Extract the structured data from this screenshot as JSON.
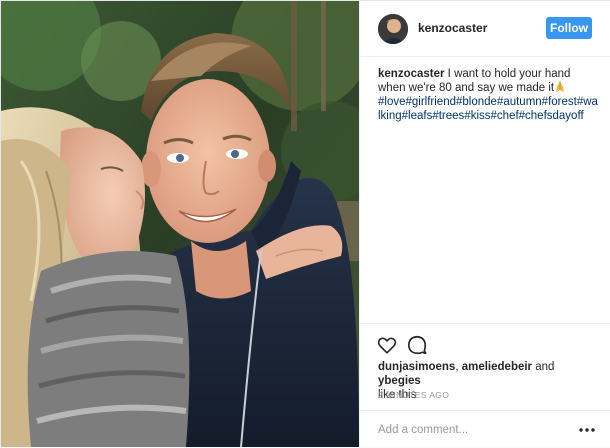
{
  "post": {
    "username": "kenzocaster",
    "follow_label": "Follow",
    "caption": {
      "username": "kenzocaster",
      "text": " I want to hold your hand when we're 80 and say we made it",
      "emoji": "praying-hands-emoji",
      "hashtags": "#love#girlfriend#blonde#autumn#forest#walking#leafs#trees#kiss#chef#chefsdayoff"
    },
    "likes": {
      "user1": "dunjasimoens",
      "separator": ", ",
      "user2": "ameliedebeir",
      "connector": " and ",
      "user3": "ybegies",
      "suffix": " like this"
    },
    "timestamp": "2 MINUTES AGO",
    "comment_placeholder": "Add a comment...",
    "icons": {
      "like": "heart-outline-icon",
      "comment": "speech-bubble-icon",
      "more": "ellipsis-icon"
    },
    "colors": {
      "follow_button": "#3897f0",
      "hashtag": "#003569",
      "muted_text": "#999999"
    }
  }
}
